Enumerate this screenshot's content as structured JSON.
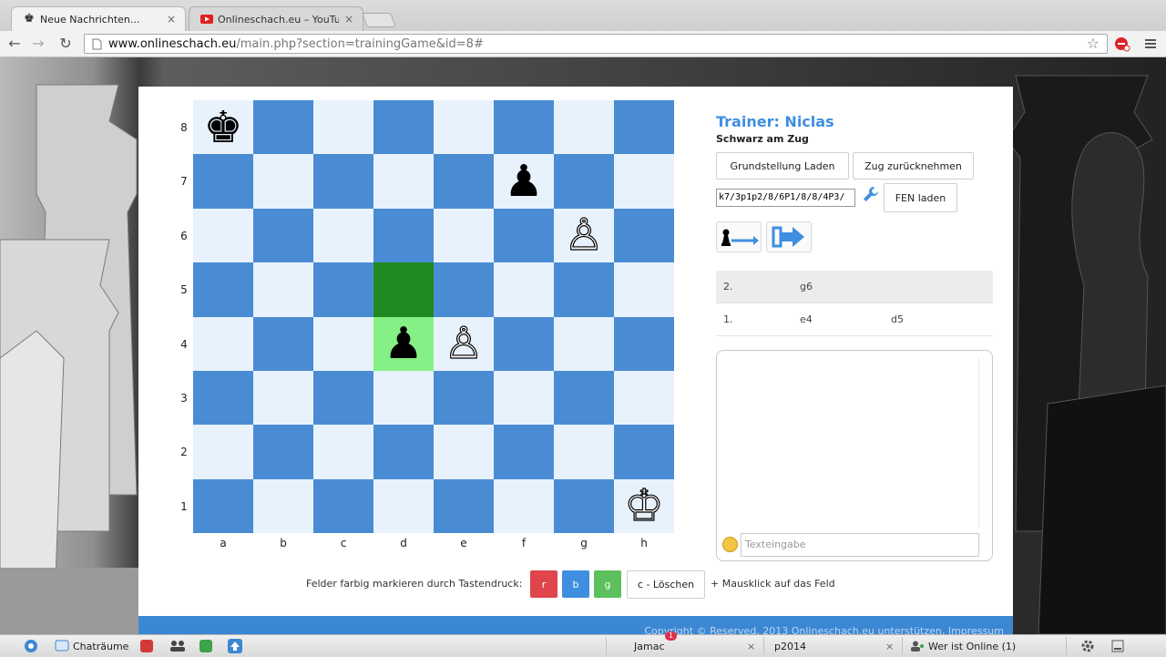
{
  "browser": {
    "tabs": [
      {
        "title": "Neue Nachrichten...",
        "close": "×"
      },
      {
        "title": "Onlineschach.eu – YouTu",
        "close": "×"
      }
    ],
    "address": {
      "host": "www.onlineschach.eu",
      "path": "/main.php?section=trainingGame&id=8#"
    },
    "nav": {
      "back": "←",
      "forward": "→",
      "reload": "↻",
      "bookmark": "☆"
    }
  },
  "board": {
    "ranks": [
      "8",
      "7",
      "6",
      "5",
      "4",
      "3",
      "2",
      "1"
    ],
    "files": [
      "a",
      "b",
      "c",
      "d",
      "e",
      "f",
      "g",
      "h"
    ],
    "pieces": {
      "a8": "♚",
      "f7": "♟",
      "g6": "♙",
      "d4": "♟",
      "e4": "♙",
      "h1": "♔"
    }
  },
  "side": {
    "trainer": "Trainer: Niclas",
    "to_move": "Schwarz am Zug",
    "load_start_button": "Grundstellung Laden",
    "undo_button": "Zug zurücknehmen",
    "fen_value": "k7/3p1p2/8/6P1/8/8/4P3/",
    "fen_button": "FEN laden"
  },
  "moves": [
    {
      "num": "2.",
      "white": "g6",
      "black": ""
    },
    {
      "num": "1.",
      "white": "e4",
      "black": "d5"
    }
  ],
  "chat": {
    "placeholder": "Texteingabe"
  },
  "marking": {
    "label": "Felder farbig markieren durch Tastendruck:",
    "keys": {
      "r": "r",
      "b": "b",
      "g": "g"
    },
    "delete_button": "c - Löschen",
    "after": "+ Mausklick auf das Feld",
    "colors": {
      "r": "#e0454b",
      "b": "#3f8ee0",
      "g": "#5cc05c"
    }
  },
  "footer": {
    "text": "Copyright © Reserved, 2013 Onlineschach.eu unterstützen, Impressum"
  },
  "taskbar": {
    "chatrooms": "Chaträume",
    "user1": "Jamac",
    "user1_badge": "1",
    "user2": "p2014",
    "online": "Wer ist Online (1)",
    "close": "×"
  }
}
